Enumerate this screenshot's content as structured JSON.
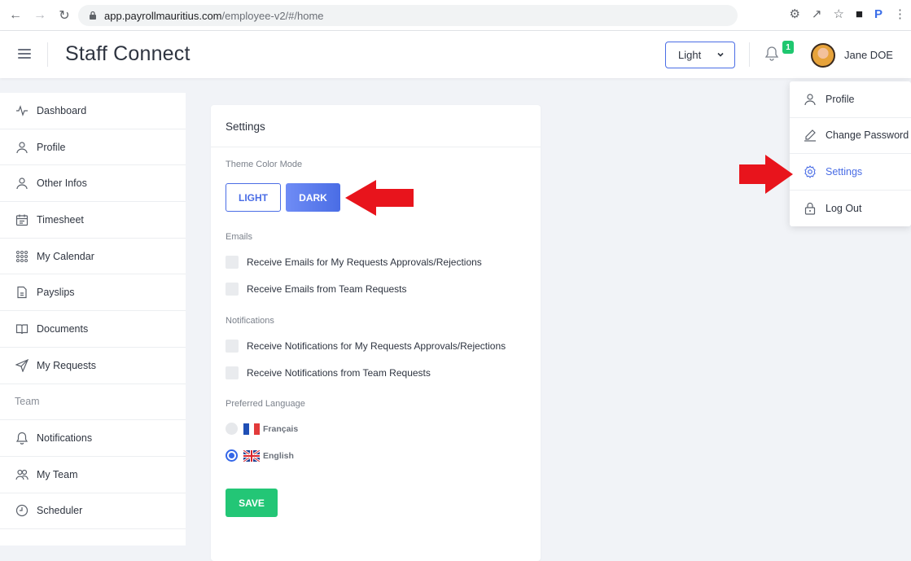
{
  "browser": {
    "url_domain": "app.payrollmauritius.com",
    "url_path": "/employee-v2/#/home"
  },
  "header": {
    "brand": "Staff Connect",
    "theme_selected": "Light",
    "notification_count": "1",
    "user_name": "Jane DOE"
  },
  "sidebar": {
    "items": [
      {
        "label": "Dashboard",
        "icon": "activity-icon"
      },
      {
        "label": "Profile",
        "icon": "user-icon"
      },
      {
        "label": "Other Infos",
        "icon": "user-icon"
      },
      {
        "label": "Timesheet",
        "icon": "calendar-icon"
      },
      {
        "label": "My Calendar",
        "icon": "grid-icon"
      },
      {
        "label": "Payslips",
        "icon": "file-icon"
      },
      {
        "label": "Documents",
        "icon": "book-icon"
      },
      {
        "label": "My Requests",
        "icon": "send-icon"
      }
    ],
    "section_team": "Team",
    "team_items": [
      {
        "label": "Notifications",
        "icon": "bell-icon"
      },
      {
        "label": "My Team",
        "icon": "users-icon"
      },
      {
        "label": "Scheduler",
        "icon": "clock-icon"
      }
    ]
  },
  "settings": {
    "title": "Settings",
    "theme_label": "Theme Color Mode",
    "light_label": "LIGHT",
    "dark_label": "DARK",
    "emails_label": "Emails",
    "email_options": [
      "Receive Emails for My Requests Approvals/Rejections",
      "Receive Emails from Team Requests"
    ],
    "notifications_label": "Notifications",
    "notification_options": [
      "Receive Notifications for My Requests Approvals/Rejections",
      "Receive Notifications from Team Requests"
    ],
    "language_label": "Preferred Language",
    "languages": [
      {
        "label": "Français",
        "checked": false
      },
      {
        "label": "English",
        "checked": true
      }
    ],
    "save_label": "SAVE"
  },
  "user_menu": {
    "items": [
      {
        "label": "Profile",
        "icon": "user-icon"
      },
      {
        "label": "Change Password",
        "icon": "pencil-icon"
      },
      {
        "label": "Settings",
        "icon": "gear-icon"
      },
      {
        "label": "Log Out",
        "icon": "lock-icon"
      }
    ]
  },
  "colors": {
    "accent": "#4a6de5",
    "save": "#23c676",
    "badge": "#1fc76f",
    "annotation_arrow": "#e8141c"
  }
}
